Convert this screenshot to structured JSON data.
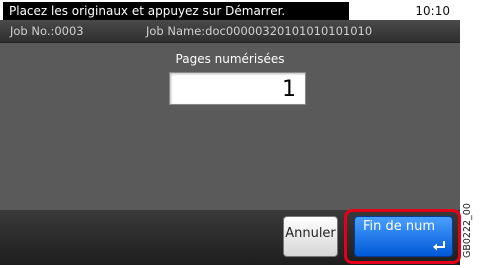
{
  "status": {
    "message": "Placez les originaux et appuyez sur Démarrer.",
    "time": "10:10"
  },
  "job": {
    "number": "Job No.:0003",
    "name": "Job Name:doc00000320101010101010"
  },
  "main": {
    "pages_label": "Pages numérisées",
    "pages_count": "1"
  },
  "buttons": {
    "cancel": "Annuler",
    "finish": "Fin de num"
  },
  "figure_id": "GB0222_00",
  "colors": {
    "accent": "#0058d8",
    "highlight": "#e4001b",
    "panel": "#5a5a5a"
  },
  "icons": {
    "finish_button": "enter-return-icon"
  }
}
